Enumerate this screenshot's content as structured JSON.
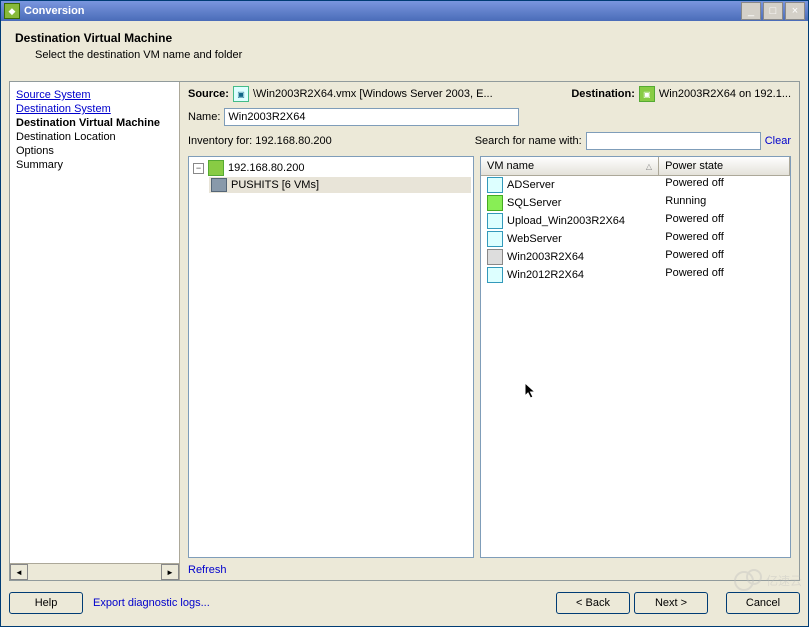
{
  "window": {
    "title": "Conversion"
  },
  "win_controls": {
    "min": "_",
    "max": "□",
    "close": "×"
  },
  "header": {
    "title": "Destination Virtual Machine",
    "subtitle": "Select the destination VM name and folder"
  },
  "nav": {
    "items": [
      {
        "label": "Source System",
        "kind": "link"
      },
      {
        "label": "Destination System",
        "kind": "link"
      },
      {
        "label": "Destination Virtual Machine",
        "kind": "current"
      },
      {
        "label": "Destination Location",
        "kind": "item"
      },
      {
        "label": "Options",
        "kind": "item"
      },
      {
        "label": "Summary",
        "kind": "item"
      }
    ]
  },
  "info": {
    "source_label": "Source:",
    "source_value": "\\Win2003R2X64.vmx [Windows Server 2003, E...",
    "dest_label": "Destination:",
    "dest_value": "Win2003R2X64 on 192.1..."
  },
  "name_field": {
    "label": "Name:",
    "value": "Win2003R2X64"
  },
  "inventory": {
    "label_prefix": "Inventory for: ",
    "host": "192.168.80.200",
    "search_label": "Search for name with:",
    "search_value": "",
    "clear": "Clear"
  },
  "tree": {
    "root": {
      "label": "192.168.80.200",
      "expanded": true
    },
    "child": {
      "label": "PUSHITS [6 VMs]"
    }
  },
  "grid": {
    "columns": [
      {
        "label": "VM name",
        "sorted": "asc"
      },
      {
        "label": "Power state"
      }
    ],
    "rows": [
      {
        "name": "ADServer",
        "state": "Powered off",
        "icon": "std"
      },
      {
        "name": "SQLServer",
        "state": "Running",
        "icon": "run"
      },
      {
        "name": "Upload_Win2003R2X64",
        "state": "Powered off",
        "icon": "std"
      },
      {
        "name": "WebServer",
        "state": "Powered off",
        "icon": "std"
      },
      {
        "name": "Win2003R2X64",
        "state": "Powered off",
        "icon": "local"
      },
      {
        "name": "Win2012R2X64",
        "state": "Powered off",
        "icon": "std"
      }
    ]
  },
  "links": {
    "refresh": "Refresh",
    "export": "Export diagnostic logs..."
  },
  "footer": {
    "help": "Help",
    "back": "< Back",
    "next": "Next >",
    "cancel": "Cancel"
  },
  "watermark": "亿速云"
}
